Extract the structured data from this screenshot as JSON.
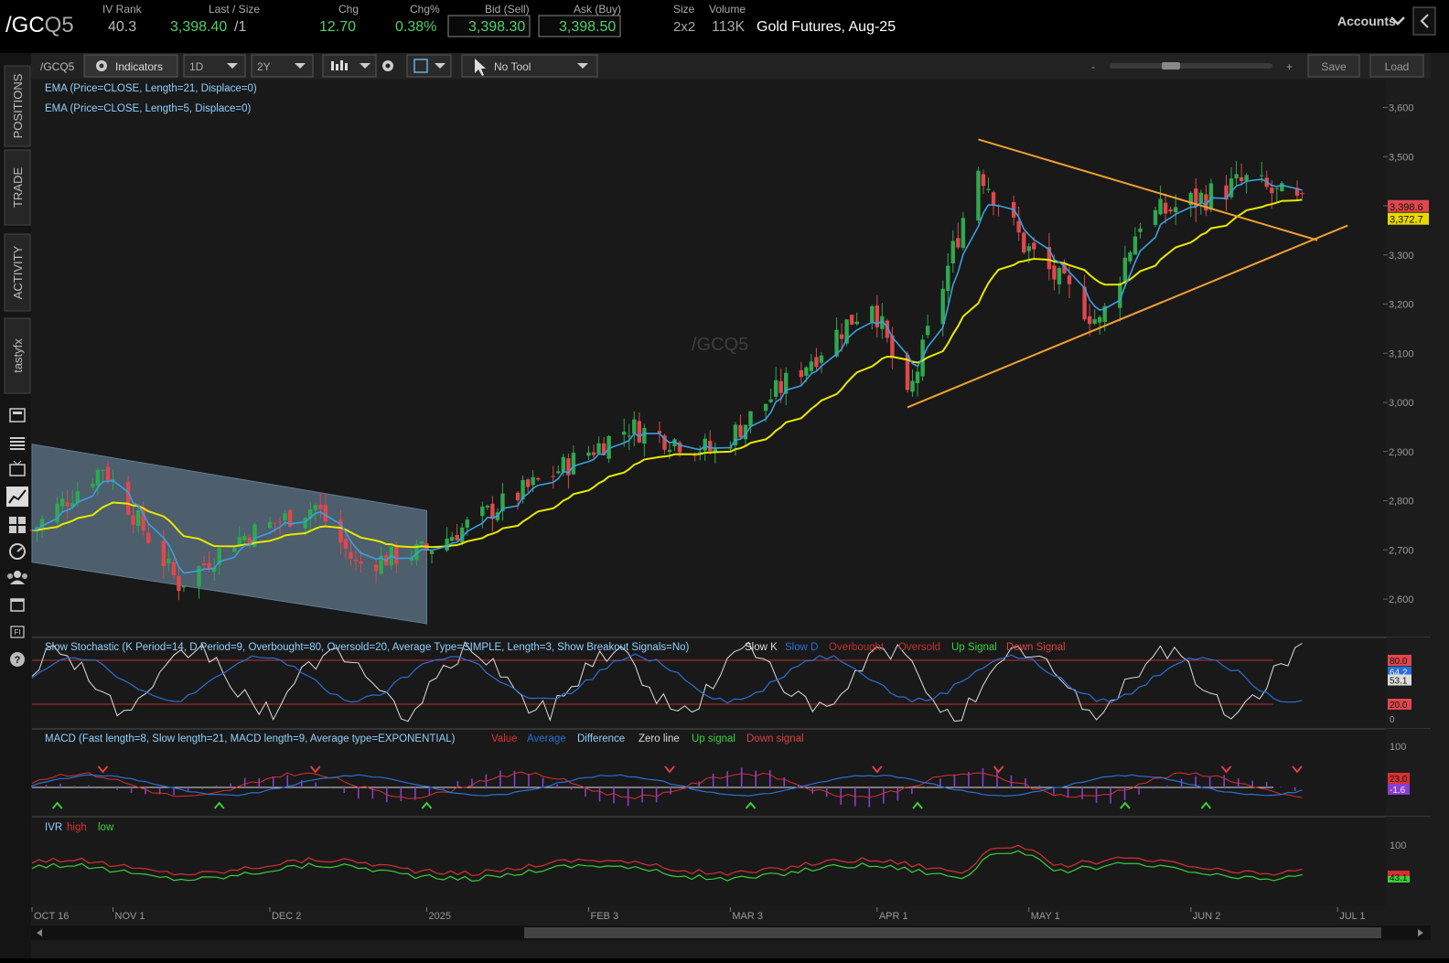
{
  "header": {
    "symbol_prefix": "/GC",
    "symbol_suffix": "Q5",
    "ivrank_label": "IV Rank",
    "ivrank_value": "40.3",
    "last_label": "Last / Size",
    "last_value": "3,398.40",
    "last_size": "/1",
    "chg_label": "Chg",
    "chg_value": "12.70",
    "chgpct_label": "Chg%",
    "chgpct_value": "0.38%",
    "bid_label": "Bid (Sell)",
    "bid_value": "3,398.30",
    "ask_label": "Ask (Buy)",
    "ask_value": "3,398.50",
    "size_label": "Size",
    "size_value": "2x2",
    "volume_label": "Volume",
    "volume_value": "113K",
    "description": "Gold Futures, Aug-25",
    "accounts_label": "Accounts"
  },
  "sidebar": {
    "tabs": [
      "POSITIONS",
      "TRADE",
      "ACTIVITY",
      "tastyfx"
    ],
    "icons": [
      "news-icon",
      "list-icon",
      "tv-icon",
      "chart-icon",
      "grid-icon",
      "dial-icon",
      "community-icon",
      "calendar-icon",
      "fi-icon",
      "help-icon"
    ]
  },
  "toolbar": {
    "symbol": "/GCQ5",
    "indicators_label": "Indicators",
    "interval": "1D",
    "range": "2Y",
    "tool_label": "No Tool",
    "zoom_minus": "-",
    "zoom_plus": "+",
    "save_label": "Save",
    "load_label": "Load"
  },
  "chart_data": [
    {
      "type": "candlestick",
      "title": "/GCQ5",
      "studies": [
        {
          "label": "EMA (Price=CLOSE, Length=21, Displace=0)",
          "color": "#e8e800"
        },
        {
          "label": "EMA (Price=CLOSE, Length=5, Displace=0)",
          "color": "#3aa0e0"
        }
      ],
      "y_ticks": [
        2600,
        2700,
        2800,
        2900,
        3000,
        3100,
        3200,
        3300,
        3400,
        3500,
        3600
      ],
      "y_tick_labels": [
        "2,600",
        "2,700",
        "2,800",
        "2,900",
        "3,000",
        "3,100",
        "3,200",
        "3,300",
        "3,400",
        "3,500",
        "3,600"
      ],
      "ylim": [
        2535,
        3640
      ],
      "x_ticks": [
        "OCT 16",
        "NOV 1",
        "DEC 2",
        "2025",
        "FEB 3",
        "MAR 3",
        "APR 1",
        "MAY 1",
        "JUN 2",
        "JUL 1"
      ],
      "x_range": [
        "2024-10-16",
        "2025-07-10"
      ],
      "price_badge_last": "3,398.6",
      "price_badge_ema": "3,372.7",
      "watermark": "/GCQ5",
      "key_closes": [
        {
          "date": "2024-10-16",
          "close": 2740
        },
        {
          "date": "2024-10-30",
          "close": 2870
        },
        {
          "date": "2024-11-14",
          "close": 2630
        },
        {
          "date": "2024-11-25",
          "close": 2720
        },
        {
          "date": "2024-12-11",
          "close": 2790
        },
        {
          "date": "2024-12-19",
          "close": 2670
        },
        {
          "date": "2025-01-02",
          "close": 2700
        },
        {
          "date": "2025-02-11",
          "close": 2950
        },
        {
          "date": "2025-02-28",
          "close": 2900
        },
        {
          "date": "2025-03-31",
          "close": 3210
        },
        {
          "date": "2025-04-07",
          "close": 3000
        },
        {
          "date": "2025-04-21",
          "close": 3480
        },
        {
          "date": "2025-04-30",
          "close": 3320
        },
        {
          "date": "2025-05-15",
          "close": 3160
        },
        {
          "date": "2025-05-23",
          "close": 3370
        },
        {
          "date": "2025-06-13",
          "close": 3450
        },
        {
          "date": "2025-06-24",
          "close": 3398
        }
      ],
      "trendlines": [
        {
          "from": {
            "date": "2025-04-21",
            "price": 3535
          },
          "to": {
            "date": "2025-06-27",
            "price": 3330
          }
        },
        {
          "from": {
            "date": "2025-04-07",
            "price": 2990
          },
          "to": {
            "date": "2025-07-03",
            "price": 3360
          }
        }
      ],
      "channel": {
        "upper": {
          "from": {
            "date": "2024-10-16",
            "price": 2915
          },
          "to": {
            "date": "2025-01-02",
            "price": 2780
          }
        },
        "lower": {
          "from": {
            "date": "2024-10-16",
            "price": 2675
          },
          "to": {
            "date": "2025-01-02",
            "price": 2550
          }
        }
      }
    },
    {
      "type": "line",
      "title": "Slow Stochastic (K Period=14, D Period=9, Overbought=80, Oversold=20, Average Type=SIMPLE, Length=3, Show Breakout Signals=No)",
      "legend": [
        "Slow K",
        "Slow D",
        "Overbought",
        "Oversold",
        "Up Signal",
        "Down Signal"
      ],
      "y_ticks": [
        0,
        20,
        80
      ],
      "badges": [
        "80.0",
        "64.2",
        "53.1",
        "20.0"
      ]
    },
    {
      "type": "line",
      "title": "MACD (Fast length=8, Slow length=21, MACD length=9, Average type=EXPONENTIAL)",
      "legend": [
        "Value",
        "Average",
        "Difference",
        "Zero line",
        "Up signal",
        "Down signal"
      ],
      "y_ticks": [
        100
      ],
      "badges": [
        "23.0",
        "-1.6"
      ]
    },
    {
      "type": "line",
      "title": "IVR",
      "legend": [
        "high",
        "low"
      ],
      "y_ticks": [
        100
      ],
      "badges": [
        "43.1"
      ]
    }
  ],
  "colors": {
    "up_candle": "#2fa84f",
    "down_candle": "#e0474c",
    "ema21": "#e8e800",
    "ema5": "#3aa0e0",
    "trendline": "#f0a030",
    "study_text": "#8fd0ff"
  }
}
